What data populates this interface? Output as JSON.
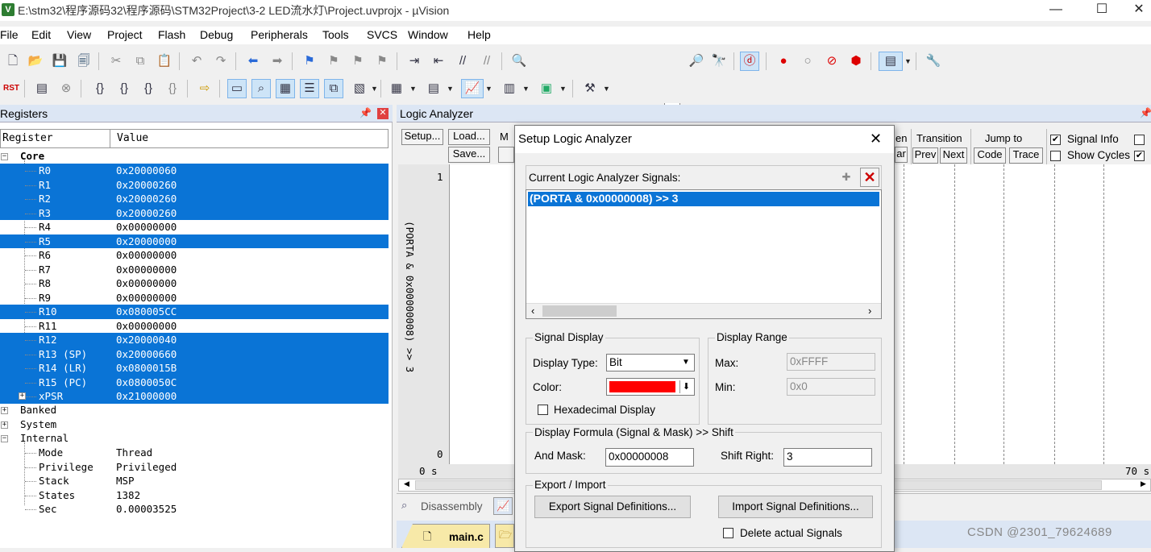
{
  "window": {
    "title": "E:\\stm32\\程序源码32\\程序源码\\STM32Project\\3-2 LED流水灯\\Project.uvprojx - µVision",
    "minimize": "—",
    "maximize": "☐",
    "close": "✕"
  },
  "menu": [
    "File",
    "Edit",
    "View",
    "Project",
    "Flash",
    "Debug",
    "Peripherals",
    "Tools",
    "SVCS",
    "Window",
    "Help"
  ],
  "registers": {
    "title": "Registers",
    "col_register": "Register",
    "col_value": "Value",
    "group_core": "Core",
    "rows": [
      {
        "name": "R0",
        "value": "0x20000060",
        "selected": true
      },
      {
        "name": "R1",
        "value": "0x20000260",
        "selected": true
      },
      {
        "name": "R2",
        "value": "0x20000260",
        "selected": true
      },
      {
        "name": "R3",
        "value": "0x20000260",
        "selected": true
      },
      {
        "name": "R4",
        "value": "0x00000000",
        "selected": false
      },
      {
        "name": "R5",
        "value": "0x20000000",
        "selected": true
      },
      {
        "name": "R6",
        "value": "0x00000000",
        "selected": false
      },
      {
        "name": "R7",
        "value": "0x00000000",
        "selected": false
      },
      {
        "name": "R8",
        "value": "0x00000000",
        "selected": false
      },
      {
        "name": "R9",
        "value": "0x00000000",
        "selected": false
      },
      {
        "name": "R10",
        "value": "0x080005CC",
        "selected": true
      },
      {
        "name": "R11",
        "value": "0x00000000",
        "selected": false
      },
      {
        "name": "R12",
        "value": "0x20000040",
        "selected": true
      },
      {
        "name": "R13 (SP)",
        "value": "0x20000660",
        "selected": true
      },
      {
        "name": "R14 (LR)",
        "value": "0x0800015B",
        "selected": true
      },
      {
        "name": "R15 (PC)",
        "value": "0x0800050C",
        "selected": true
      },
      {
        "name": "xPSR",
        "value": "0x21000000",
        "selected": true
      }
    ],
    "group_banked": "Banked",
    "group_system": "System",
    "group_internal": "Internal",
    "internal": [
      {
        "name": "Mode",
        "value": "Thread"
      },
      {
        "name": "Privilege",
        "value": "Privileged"
      },
      {
        "name": "Stack",
        "value": "MSP"
      },
      {
        "name": "States",
        "value": "1382"
      },
      {
        "name": "Sec",
        "value": "0.00003525"
      }
    ]
  },
  "logic_analyzer": {
    "title": "Logic Analyzer",
    "setup": "Setup...",
    "load": "Load...",
    "save": "Save...",
    "m_clip": "M",
    "en_clip": "en",
    "ar_clip": "ar",
    "transition": "Transition",
    "prev": "Prev",
    "next": "Next",
    "jump_to": "Jump to",
    "code": "Code",
    "trace": "Trace",
    "signal_info": "Signal Info",
    "show_cycles": "Show Cycles",
    "signal_label": "(PORTA & 0x00000008) >> 3",
    "y_top": "1",
    "y_bottom": "0",
    "time_start": "0 s",
    "time_end": "70 s"
  },
  "bottom_tabs": {
    "disassembly": "Disassembly",
    "file_tab": "main.c"
  },
  "dialog": {
    "title": "Setup Logic Analyzer",
    "signals_label": "Current Logic Analyzer Signals:",
    "signals": [
      "(PORTA & 0x00000008) >> 3"
    ],
    "signal_display": "Signal Display",
    "display_type_label": "Display Type:",
    "display_type": "Bit",
    "color_label": "Color:",
    "color": "#ff0000",
    "hex_display": "Hexadecimal Display",
    "display_range": "Display Range",
    "max_label": "Max:",
    "max": "0xFFFF",
    "min_label": "Min:",
    "min": "0x0",
    "formula": "Display Formula (Signal & Mask) >> Shift",
    "and_mask_label": "And Mask:",
    "and_mask": "0x00000008",
    "shift_right_label": "Shift Right:",
    "shift_right": "3",
    "export_import": "Export / Import",
    "export_btn": "Export Signal Definitions...",
    "import_btn": "Import Signal Definitions...",
    "delete_actual": "Delete actual Signals"
  },
  "watermark": "CSDN @2301_79624689",
  "colors": {
    "selection": "#0a74d6",
    "panel_title": "#dce6f4"
  }
}
